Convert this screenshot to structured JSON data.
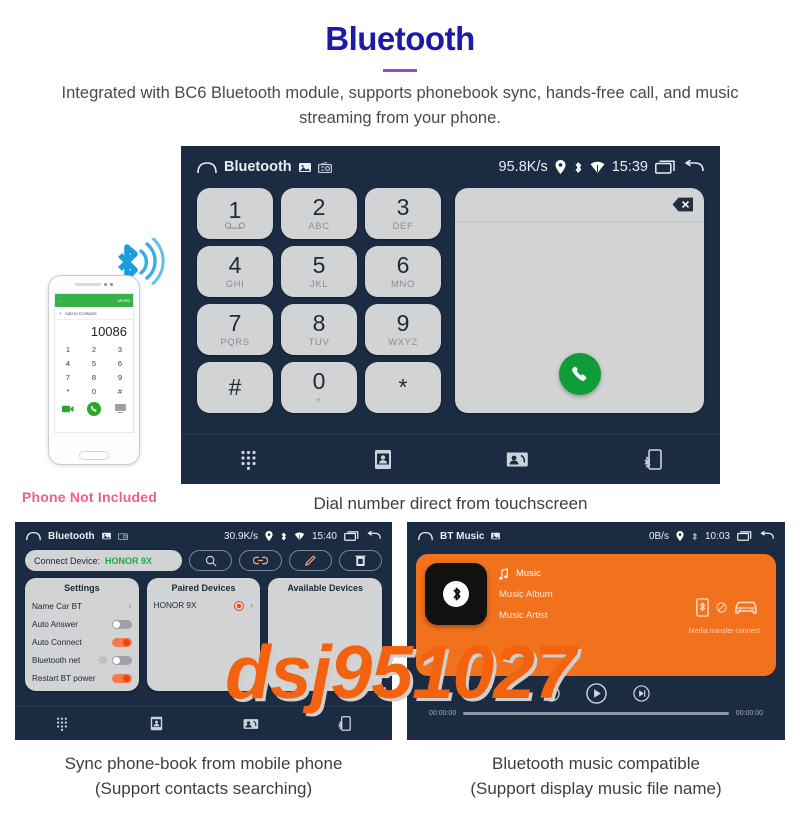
{
  "header": {
    "title": "Bluetooth",
    "subtitle": "Integrated with BC6 Bluetooth module, supports phonebook sync, hands-free call, and music streaming from your phone.",
    "title_color": "#1d1aa8",
    "rule_color": "#8a4fcf"
  },
  "main_screen": {
    "statusbar": {
      "title": "Bluetooth",
      "speed": "95.8K/s",
      "time": "15:39",
      "icons": [
        "home-icon",
        "gallery-icon",
        "radio-icon",
        "location-pin-icon",
        "bluetooth-icon",
        "wifi-icon",
        "recents-icon",
        "back-icon"
      ]
    },
    "keypad": [
      {
        "num": "1",
        "sub": "∞"
      },
      {
        "num": "2",
        "sub": "ABC"
      },
      {
        "num": "3",
        "sub": "DEF"
      },
      {
        "num": "4",
        "sub": "GHI"
      },
      {
        "num": "5",
        "sub": "JKL"
      },
      {
        "num": "6",
        "sub": "MNO"
      },
      {
        "num": "7",
        "sub": "PQRS"
      },
      {
        "num": "8",
        "sub": "TUV"
      },
      {
        "num": "9",
        "sub": "WXYZ"
      },
      {
        "num": "#",
        "sub": ""
      },
      {
        "num": "0",
        "sub": "+"
      },
      {
        "num": "*",
        "sub": ""
      }
    ],
    "number_display": "",
    "nav": [
      "dialpad-icon",
      "contacts-icon",
      "call-log-icon",
      "bluetooth-phone-icon"
    ]
  },
  "phone_mock": {
    "status_left": "←",
    "status_right": "MORE",
    "add_contacts": "Add to Contacts",
    "number": "10086",
    "keys": [
      "1",
      "2",
      "3",
      "4",
      "5",
      "6",
      "7",
      "8",
      "9",
      "*",
      "0",
      "#"
    ],
    "not_included": "Phone Not Included"
  },
  "captions": {
    "main": "Dial number direct from touchscreen",
    "bottom_left": "Sync phone-book from mobile phone\n(Support contacts searching)",
    "bottom_left_line1": "Sync phone-book from mobile phone",
    "bottom_left_line2": "(Support contacts searching)",
    "bottom_right_line1": "Bluetooth music compatible",
    "bottom_right_line2": "(Support display music file name)"
  },
  "bt_screen": {
    "statusbar": {
      "title": "Bluetooth",
      "speed": "30.9K/s",
      "time": "15:40"
    },
    "connect_label": "Connect Device:",
    "connect_device": "HONOR 9X",
    "connect_device_color": "#1fa84a",
    "action_buttons": [
      "search-icon",
      "link-icon",
      "edit-icon",
      "trash-icon"
    ],
    "settings_card": {
      "title": "Settings",
      "rows": [
        {
          "label": "Name  Car BT",
          "control": "chevron"
        },
        {
          "label": "Auto Answer",
          "control": "toggle",
          "state": "off"
        },
        {
          "label": "Auto Connect",
          "control": "toggle",
          "state": "on"
        },
        {
          "label": "Bluetooth net",
          "control": "toggle",
          "state": "off",
          "extra_icon": "gear-icon"
        },
        {
          "label": "Restart BT power",
          "control": "toggle",
          "state": "on"
        }
      ]
    },
    "paired_card": {
      "title": "Paired Devices",
      "devices": [
        "HONOR 9X"
      ]
    },
    "available_card": {
      "title": "Available Devices",
      "devices": []
    },
    "nav": [
      "dialpad-icon",
      "contacts-icon",
      "call-log-icon",
      "bluetooth-phone-icon"
    ]
  },
  "music_screen": {
    "statusbar": {
      "title": "BT Music",
      "speed": "0B/s",
      "time": "10:03"
    },
    "track": "Music",
    "album": "Music Album",
    "artist": "Music Artist",
    "transfer_note": "Media transfer connect",
    "time_elapsed": "00:00:00",
    "time_total": "00:00:00",
    "accent": "#f2711c"
  },
  "watermark": "dsj951027"
}
